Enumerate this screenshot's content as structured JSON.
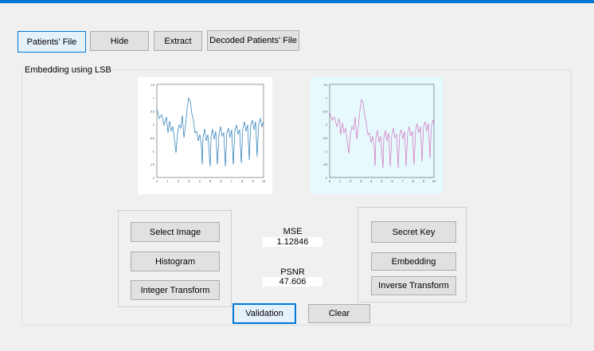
{
  "tabs": [
    "Patients' File",
    "Hide",
    "Extract",
    "Decoded Patients' File"
  ],
  "group_title": "Embedding using LSB",
  "plots": {
    "x_ticks": [
      "0",
      "1",
      "2",
      "3",
      "4",
      "5",
      "6",
      "7",
      "8",
      "9",
      "10"
    ],
    "y_ticks": [
      "1.5",
      "1",
      "0.5",
      "0",
      "-0.5",
      "-1",
      "-1.5",
      "-2"
    ],
    "original_color": "#1f77b4",
    "stego_color": "#d070c0",
    "stego_bg": "#e6f9fc"
  },
  "left_buttons": [
    "Select Image",
    "Histogram",
    "Integer Transform"
  ],
  "right_buttons": [
    "Secret Key",
    "Embedding",
    "Inverse Transform"
  ],
  "mse": {
    "label": "MSE",
    "value": "1.12846"
  },
  "psnr": {
    "label": "PSNR",
    "value": "47.606"
  },
  "bottom_buttons": {
    "validation": "Validation",
    "clear": "Clear"
  }
}
